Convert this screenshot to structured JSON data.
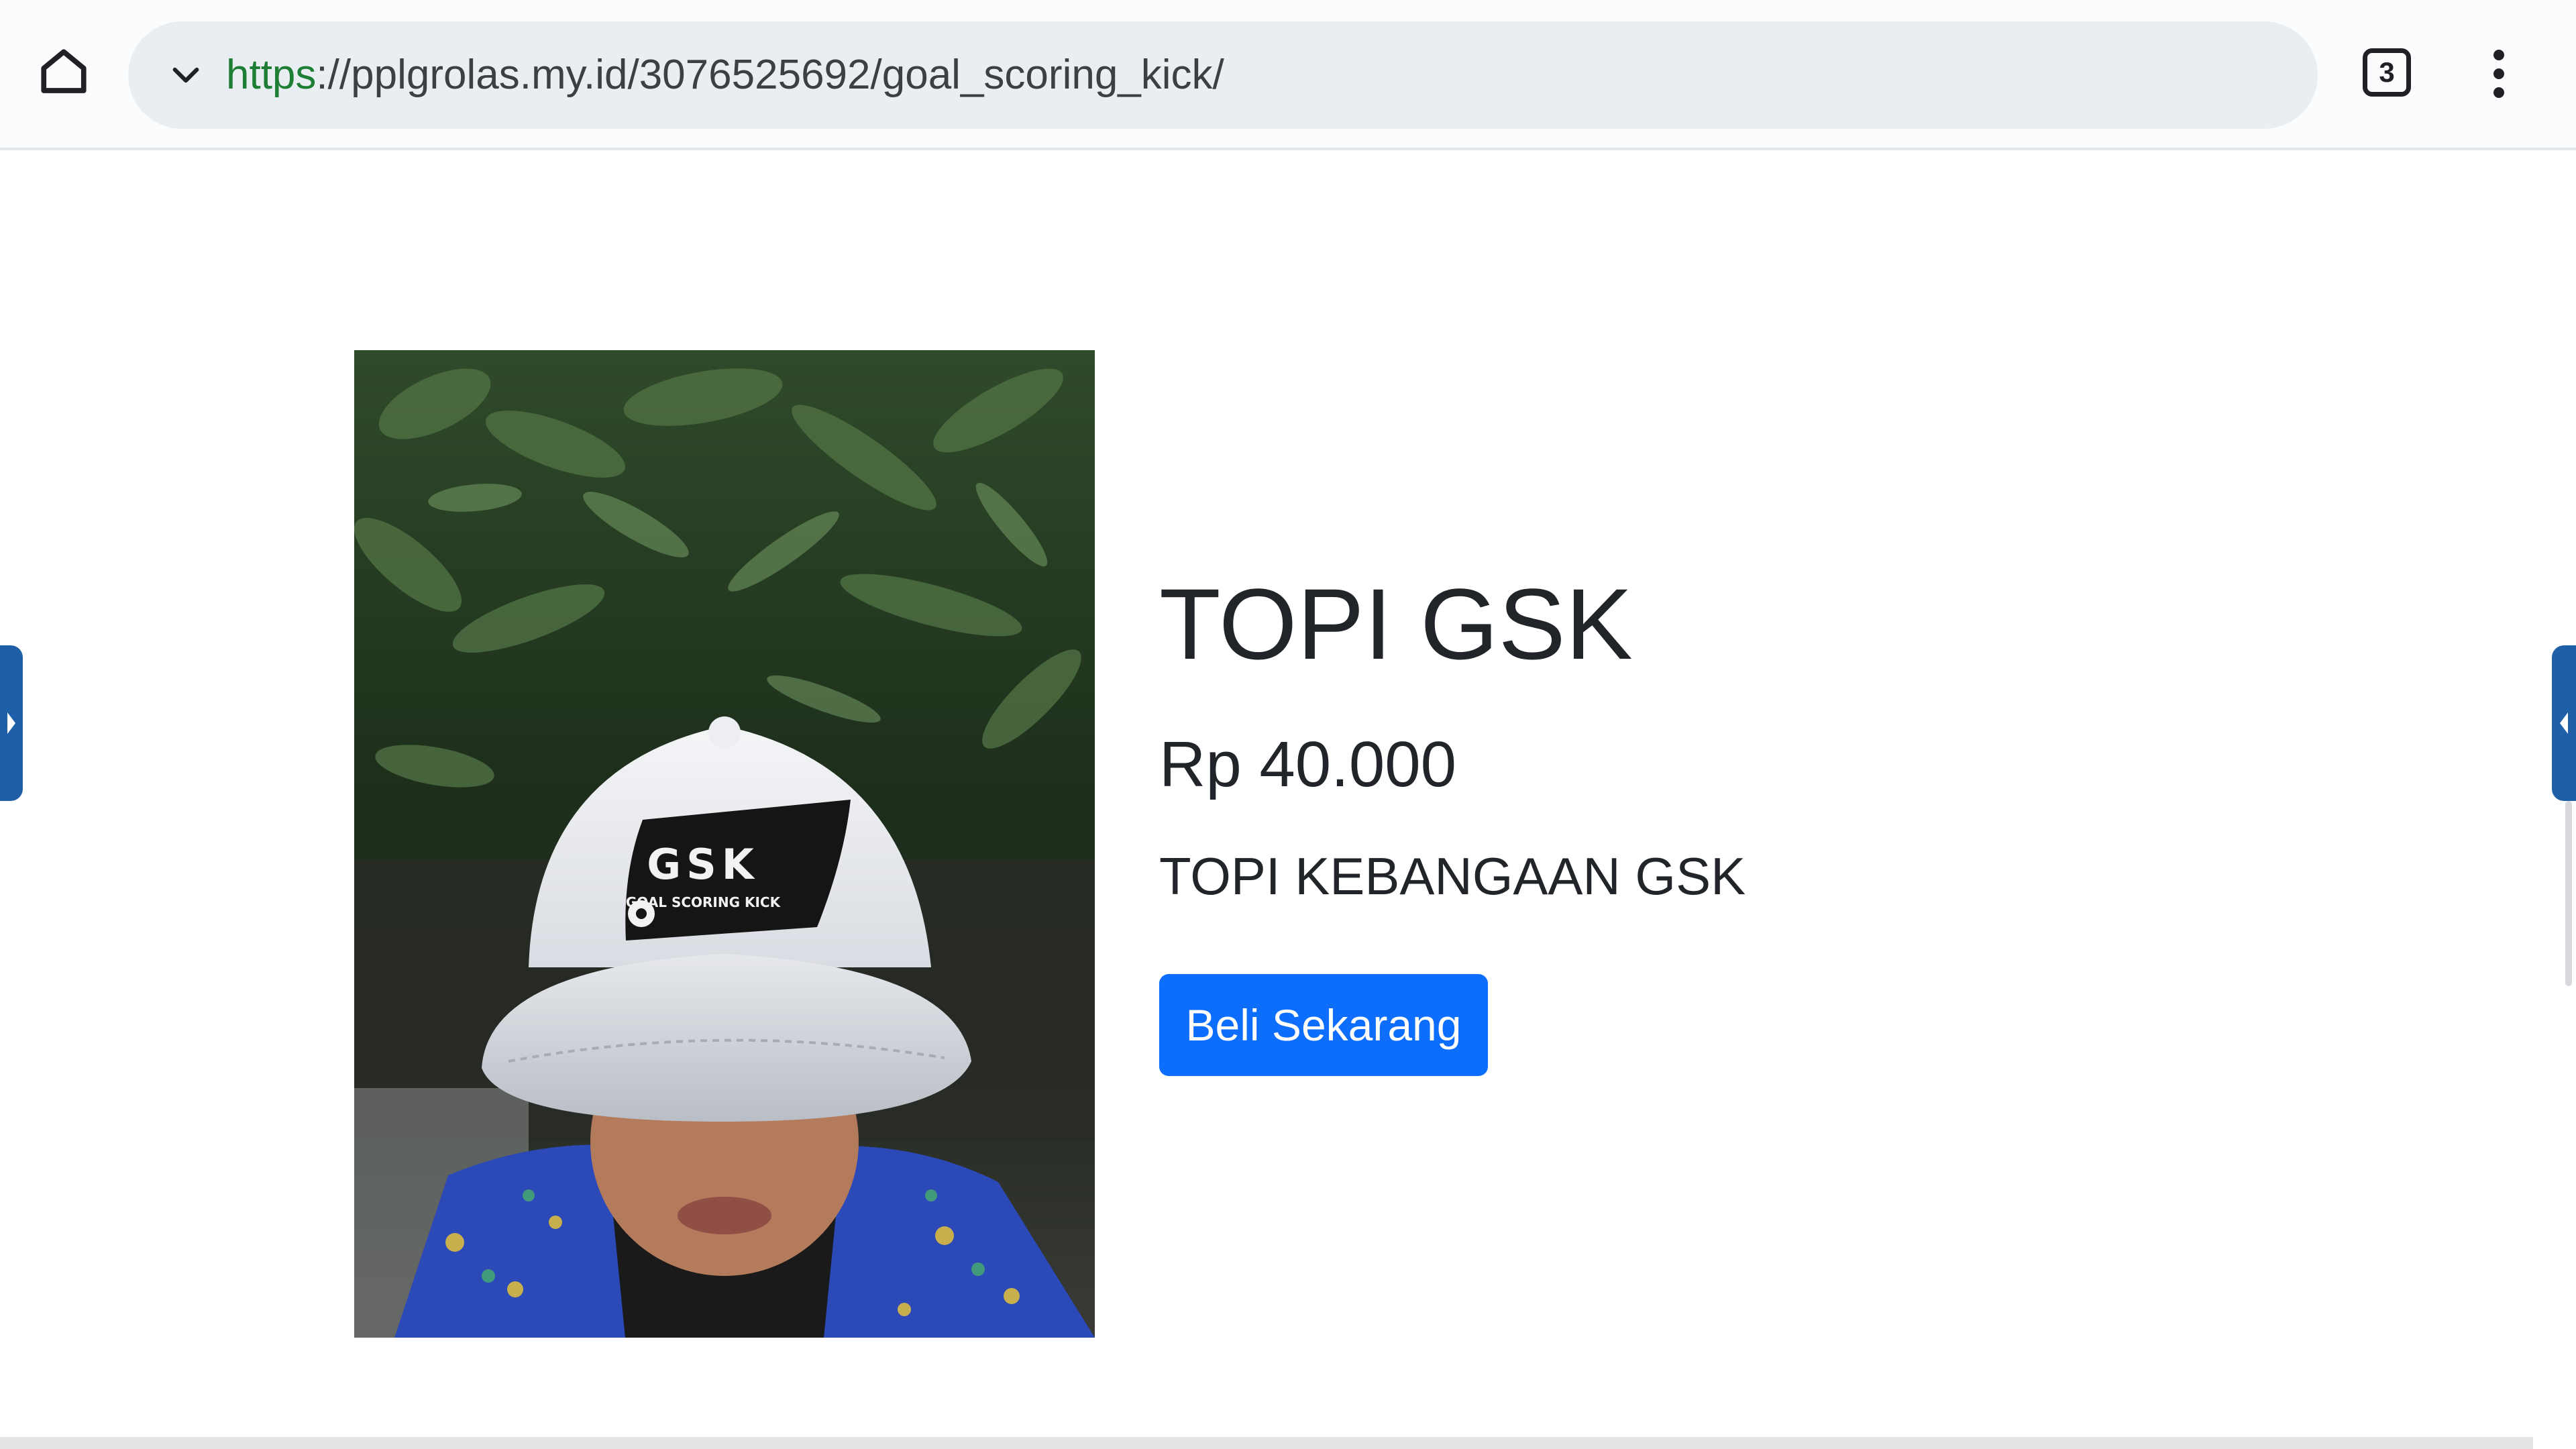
{
  "browser": {
    "url_scheme": "https",
    "url_separator": "://",
    "url_host": "pplgrolas.my.id",
    "url_path": "/3076525692/goal_scoring_kick/",
    "tab_count": "3",
    "icons": {
      "home": "home-icon",
      "omnibox": "chevron-down-icon",
      "menu": "more-vertical-icon"
    }
  },
  "product": {
    "title": "TOPI GSK",
    "price": "Rp 40.000",
    "description": "TOPI KEBANGAAN GSK",
    "buy_label": "Beli Sekarang",
    "image_alt": "TOPI GSK",
    "cap_logo_text": "GSK",
    "cap_logo_subtext": "GOAL SCORING KICK"
  },
  "colors": {
    "accent": "#0d6efd",
    "url_scheme": "#1e7e34",
    "edge_handle": "#1f5fa8",
    "text": "#212529"
  }
}
